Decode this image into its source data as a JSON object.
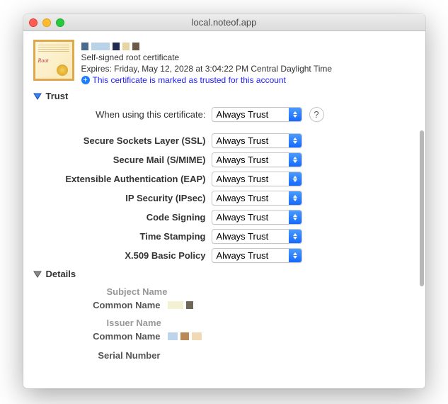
{
  "window": {
    "title": "local.noteof.app"
  },
  "header": {
    "type": "Self-signed root certificate",
    "expires": "Expires: Friday, May 12, 2028 at 3:04:22 PM Central Daylight Time",
    "trusted": "This certificate is marked as trusted for this account"
  },
  "trust": {
    "section_label": "Trust",
    "main_label": "When using this certificate:",
    "main_value": "Always Trust",
    "help_label": "?",
    "rows": [
      {
        "label": "Secure Sockets Layer (SSL)",
        "value": "Always Trust"
      },
      {
        "label": "Secure Mail (S/MIME)",
        "value": "Always Trust"
      },
      {
        "label": "Extensible Authentication (EAP)",
        "value": "Always Trust"
      },
      {
        "label": "IP Security (IPsec)",
        "value": "Always Trust"
      },
      {
        "label": "Code Signing",
        "value": "Always Trust"
      },
      {
        "label": "Time Stamping",
        "value": "Always Trust"
      },
      {
        "label": "X.509 Basic Policy",
        "value": "Always Trust"
      }
    ]
  },
  "details": {
    "section_label": "Details",
    "subject_heading": "Subject Name",
    "subject_common_name_label": "Common Name",
    "issuer_heading": "Issuer Name",
    "issuer_common_name_label": "Common Name",
    "serial_label": "Serial Number",
    "serial_value": ""
  }
}
